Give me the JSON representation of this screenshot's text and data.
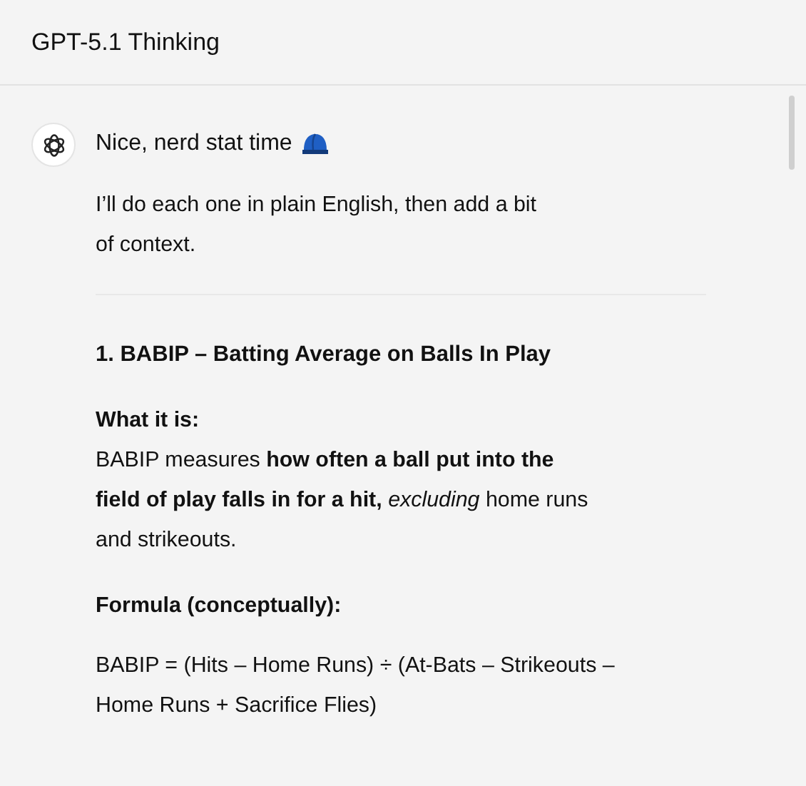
{
  "window": {
    "title": "GPT-5.1 Thinking"
  },
  "message": {
    "blocks": [
      {
        "kind": "intro",
        "text": "Nice, nerd stat time"
      },
      {
        "kind": "paragraph",
        "text": "I’ll do each one in plain English, then add a bit\nof context."
      },
      {
        "kind": "rule"
      },
      {
        "kind": "heading",
        "text": "1. BABIP – Batting Average on Balls In Play"
      },
      {
        "kind": "definition",
        "label": "What it is:",
        "text": "BABIP measures **how often a ball put into the\nfield of play falls in for a hit,** *excluding* home runs\nand strikeouts."
      },
      {
        "kind": "label",
        "text": "Formula (conceptually):"
      },
      {
        "kind": "paragraph",
        "text": "BABIP = (Hits – Home Runs) ÷ (At-Bats – Strikeouts –\nHome Runs + Sacrifice Flies)"
      }
    ]
  }
}
